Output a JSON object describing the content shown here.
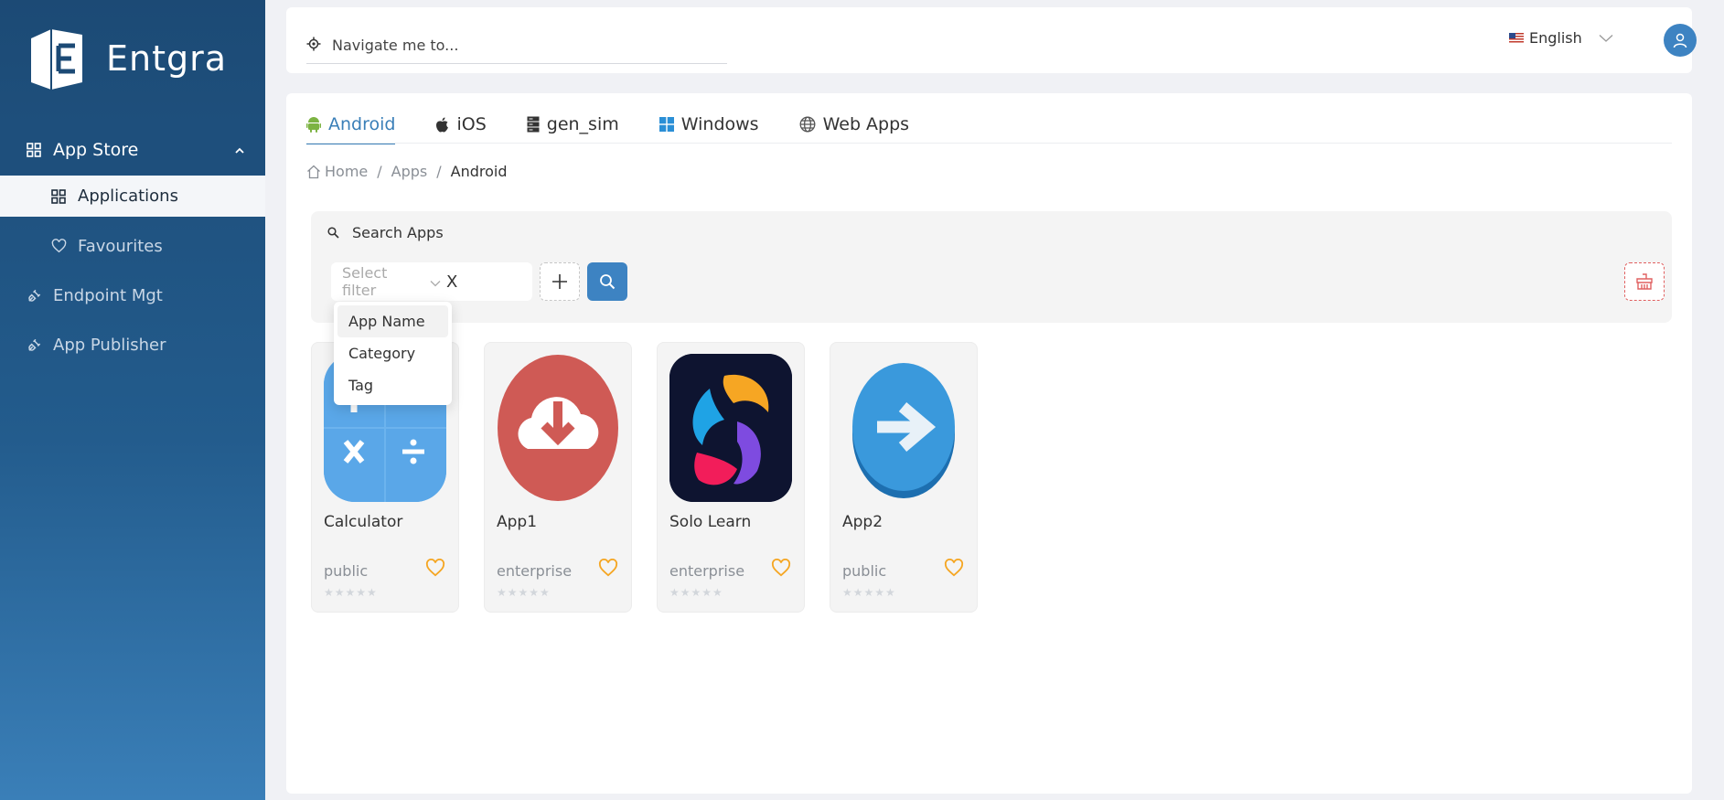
{
  "brand": {
    "name": "Entgra"
  },
  "sidebar": {
    "group": {
      "label": "App Store"
    },
    "items": [
      {
        "label": "Applications"
      },
      {
        "label": "Favourites"
      }
    ],
    "sections": [
      {
        "label": "Endpoint Mgt"
      },
      {
        "label": "App Publisher"
      }
    ]
  },
  "header": {
    "nav_placeholder": "Navigate me to...",
    "language": "English"
  },
  "tabs": [
    {
      "label": "Android",
      "icon": "android-icon"
    },
    {
      "label": "iOS",
      "icon": "apple-icon"
    },
    {
      "label": "gen_sim",
      "icon": "server-icon"
    },
    {
      "label": "Windows",
      "icon": "windows-icon"
    },
    {
      "label": "Web Apps",
      "icon": "globe-icon"
    }
  ],
  "breadcrumb": {
    "home": "Home",
    "apps": "Apps",
    "current": "Android",
    "sep": "/"
  },
  "search": {
    "title": "Search Apps",
    "filter_placeholder": "Select filter",
    "filter_value": "X"
  },
  "filter_options": [
    "App Name",
    "Category",
    "Tag"
  ],
  "apps": [
    {
      "name": "Calculator",
      "type": "public",
      "rating": 0
    },
    {
      "name": "App1",
      "type": "enterprise",
      "rating": 0
    },
    {
      "name": "Solo Learn",
      "type": "enterprise",
      "rating": 0
    },
    {
      "name": "App2",
      "type": "public",
      "rating": 0
    }
  ],
  "stars_glyph": "★★★★★",
  "colors": {
    "primary": "#3d83c2",
    "sidebar": "#1c4a75",
    "favourite": "#f5a623",
    "danger": "#e06060"
  }
}
